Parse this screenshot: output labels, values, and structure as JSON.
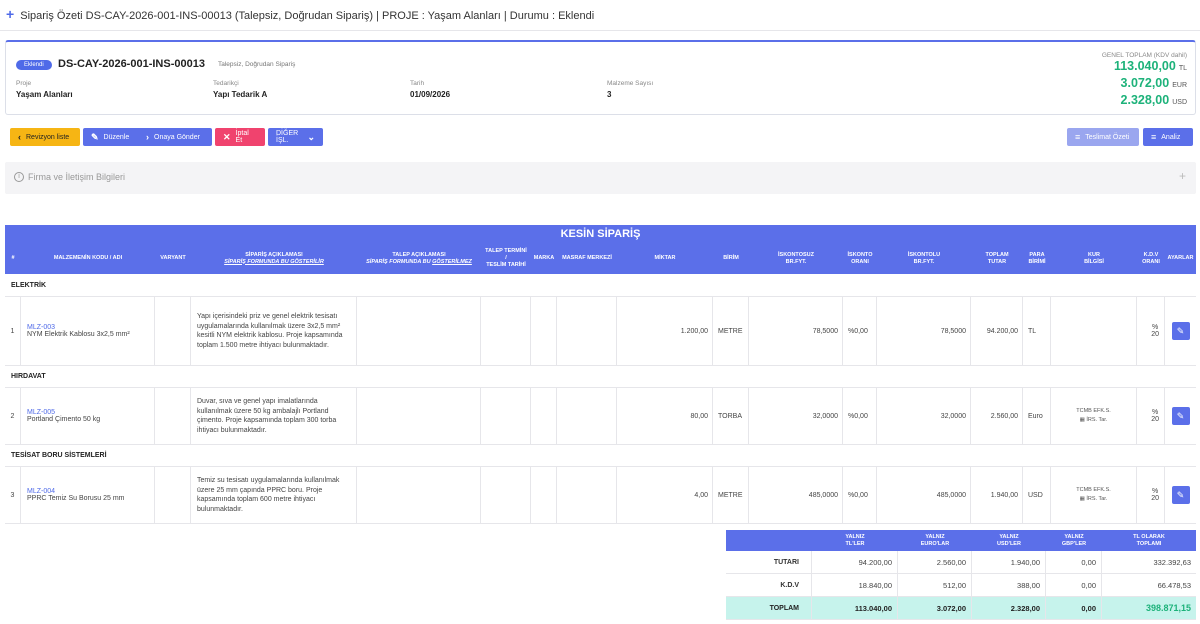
{
  "topbar": {
    "title_prefix": "Sipariş Özeti",
    "title_rest": "DS-CAY-2026-001-INS-00013 (Talepsiz, Doğrudan Sipariş) | PROJE : Yaşam Alanları | Durumu : Eklendi"
  },
  "header": {
    "badge": "Eklendi",
    "order_code": "DS-CAY-2026-001-INS-00013",
    "order_sub": "Talepsiz, Doğrudan Sipariş",
    "fields": [
      {
        "label": "Proje",
        "value": "Yaşam Alanları"
      },
      {
        "label": "Tedarikçi",
        "value": "Yapı Tedarik A"
      },
      {
        "label": "Tarih",
        "value": "01/09/2026"
      },
      {
        "label": "Malzeme Sayısı",
        "value": "3"
      }
    ],
    "grand_label": "GENEL TOPLAM (KDV dahil)",
    "grand_totals": [
      {
        "amount": "113.040,00",
        "currency": "TL"
      },
      {
        "amount": "3.072,00",
        "currency": "EUR"
      },
      {
        "amount": "2.328,00",
        "currency": "USD"
      }
    ]
  },
  "toolbar": {
    "revizyon": "Revizyon liste",
    "duzenle": "Düzenle",
    "onaya": "Onaya Gönder",
    "iptal": "İptal Et",
    "diger": "DİĞER İŞL.",
    "teslimat": "Teslimat Özeti",
    "analiz": "Analiz"
  },
  "firma": {
    "title": "Firma ve İletişim Bilgileri"
  },
  "table": {
    "title": "KESİN SİPARİŞ",
    "headers": {
      "no": "#",
      "kod": "MALZEMENİN KODU / ADI",
      "varyant": "VARYANT",
      "siparis_aciklama": "SİPARİŞ AÇIKLAMASI",
      "siparis_aciklama_sub": "SİPARİŞ FORMUNDA BU GÖSTERİLİR",
      "talep_aciklama": "TALEP AÇIKLAMASI",
      "talep_aciklama_sub": "SİPARİŞ FORMUNDA BU",
      "talep_aciklama_sub2": "GÖSTERİLMEZ",
      "talep_termini": "TALEP TERMİNİ",
      "talep_slash": "/",
      "teslim_tarihi": "TESLİM TARİHİ",
      "marka": "MARKA",
      "masraf": "MASRAF MERKEZİ",
      "miktar": "MİKTAR",
      "birim": "BİRİM",
      "iskontosuz": "İSKONTOSUZ",
      "iskontosuz2": "BR.FYT.",
      "iskonto": "İSKONTO",
      "iskonto2": "ORANI",
      "iskontolu": "İSKONTOLU",
      "iskontolu2": "BR.FYT.",
      "toplam": "TOPLAM",
      "toplam2": "TUTAR",
      "para": "PARA",
      "para2": "BİRİMİ",
      "kur": "KUR",
      "kur2": "BİLGİSİ",
      "kdv": "K.D.V",
      "kdv2": "ORANI",
      "ayarlar": "AYARLAR"
    },
    "groups": [
      {
        "name": "ELEKTRİK",
        "row": {
          "no": "1",
          "code": "MLZ-003",
          "name": "NYM Elektrik Kablosu 3x2,5 mm²",
          "desc": "Yapı içerisindeki priz ve genel elektrik tesisatı uygulamalarında kullanılmak üzere 3x2,5 mm² kesitli NYM elektrik kablosu. Proje kapsamında toplam 1.500 metre ihtiyacı bulunmaktadır.",
          "miktar": "1.200,00",
          "birim": "METRE",
          "iskontosuz": "78,5000",
          "iskonto": "%0,00",
          "iskontolu": "78,5000",
          "toplam": "94.200,00",
          "para": "TL",
          "kur1": "",
          "kur2": "",
          "kdv1": "%",
          "kdv2": "20"
        }
      },
      {
        "name": "HIRDAVAT",
        "row": {
          "no": "2",
          "code": "MLZ-005",
          "name": "Portland Çimento 50 kg",
          "desc": "Duvar, sıva ve genel yapı imalatlarında kullanılmak üzere 50 kg ambalajlı Portland çimento. Proje kapsamında toplam 300 torba ihtiyacı bulunmaktadır.",
          "miktar": "80,00",
          "birim": "TORBA",
          "iskontosuz": "32,0000",
          "iskonto": "%0,00",
          "iskontolu": "32,0000",
          "toplam": "2.560,00",
          "para": "Euro",
          "kur1": "TCMB EFK.S.",
          "kur2": "İRS. Tar.",
          "kdv1": "%",
          "kdv2": "20"
        }
      },
      {
        "name": "TESİSAT BORU SİSTEMLERİ",
        "row": {
          "no": "3",
          "code": "MLZ-004",
          "name": "PPRC Temiz Su Borusu 25 mm",
          "desc": "Temiz su tesisatı uygulamalarında kullanılmak üzere 25 mm çapında PPRC boru. Proje kapsamında toplam 600 metre ihtiyacı bulunmaktadır.",
          "miktar": "4,00",
          "birim": "METRE",
          "iskontosuz": "485,0000",
          "iskonto": "%0,00",
          "iskontolu": "485,0000",
          "toplam": "1.940,00",
          "para": "USD",
          "kur1": "TCMB EFK.S.",
          "kur2": "İRS. Tar.",
          "kdv1": "%",
          "kdv2": "20"
        }
      }
    ]
  },
  "summary": {
    "headers": [
      {
        "l1": "YALNIZ",
        "l2": "TL'LER"
      },
      {
        "l1": "YALNIZ",
        "l2": "EURO'LAR"
      },
      {
        "l1": "YALNIZ",
        "l2": "USD'LER"
      },
      {
        "l1": "YALNIZ",
        "l2": "GBP'LER"
      },
      {
        "l1": "TL OLARAK",
        "l2": "TOPLAMI"
      }
    ],
    "rows": [
      {
        "label": "TUTARI",
        "values": [
          "94.200,00",
          "2.560,00",
          "1.940,00",
          "0,00",
          "332.392,63"
        ]
      },
      {
        "label": "K.D.V",
        "values": [
          "18.840,00",
          "512,00",
          "388,00",
          "0,00",
          "66.478,53"
        ]
      },
      {
        "label": "TOPLAM",
        "values": [
          "113.040,00",
          "3.072,00",
          "2.328,00",
          "0,00",
          "398.871,15"
        ]
      }
    ],
    "colors": {
      "total_bg": "#c6f3ec",
      "total_highlight": "#1db27a"
    }
  }
}
